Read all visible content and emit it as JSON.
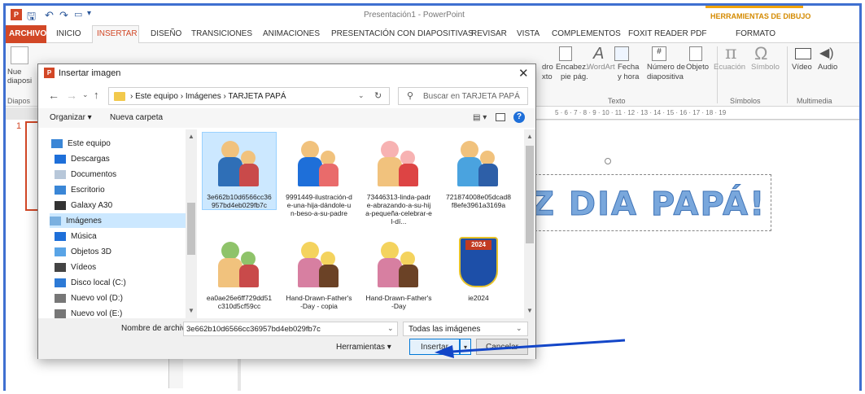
{
  "title_bar": {
    "title": "Presentación1 - PowerPoint",
    "contextual_title": "HERRAMIENTAS DE DIBUJO"
  },
  "tabs": [
    "ARCHIVO",
    "INICIO",
    "INSERTAR",
    "DISEÑO",
    "TRANSICIONES",
    "ANIMACIONES",
    "PRESENTACIÓN CON DIAPOSITIVAS",
    "REVISAR",
    "VISTA",
    "COMPLEMENTOS",
    "FOXIT READER PDF",
    "FORMATO"
  ],
  "ribbon": {
    "left_new_slide": "Nue diaposi",
    "left_group": "Diapos",
    "text_items": [
      "dro",
      "xto",
      "Encabez.",
      "pie pág.",
      "WordArt",
      "Fecha",
      "y hora",
      "Número de",
      "diapositiva",
      "Objeto"
    ],
    "text_group": "Texto",
    "symbols": [
      "Ecuación",
      "Símbolo"
    ],
    "symbols_group": "Símbolos",
    "media": [
      "Vídeo",
      "Audio"
    ],
    "media_group": "Multimedia"
  },
  "ruler": "5 · 6 · 7 · 8 · 9 · 10 · 11 · 12 · 13 · 14 · 15 · 16 · 17 · 18 · 19",
  "slide": {
    "number": "1",
    "wordart": "Z DIA PAPÁ!"
  },
  "dialog": {
    "title": "Insertar imagen",
    "breadcrumb": [
      "Este equipo",
      "Imágenes",
      "TARJETA PAPÁ"
    ],
    "search_placeholder": "Buscar en TARJETA PAPÁ",
    "organize": "Organizar ▾",
    "new_folder": "Nueva carpeta",
    "nav_items": [
      "Este equipo",
      "Descargas",
      "Documentos",
      "Escritorio",
      "Galaxy A30",
      "Imágenes",
      "Música",
      "Objetos 3D",
      "Vídeos",
      "Disco local (C:)",
      "Nuevo vol (D:)",
      "Nuevo vol (E:)"
    ],
    "nav_selected": "Imágenes",
    "files": [
      {
        "name": "3e662b10d6566cc36957bd4eb029fb7c",
        "selected": true
      },
      {
        "name": "9991449-ilustración-de-una-hija-dándole-un-beso-a-su-padre"
      },
      {
        "name": "73446313-linda-padre-abrazando-a-su-hija-pequeña-celebrar-el-dí..."
      },
      {
        "name": "721874008e05dcad8f8efe3961a3169a"
      },
      {
        "name": "ea0ae26e6ff729dd51c310d5cf59cc"
      },
      {
        "name": "Hand-Drawn-Father's-Day - copia"
      },
      {
        "name": "Hand-Drawn-Father's-Day"
      },
      {
        "name": "ie2024",
        "badge_text": "2024"
      }
    ],
    "file_name_label": "Nombre de archivo:",
    "file_name_value": "3e662b10d6566cc36957bd4eb029fb7c",
    "filter": "Todas las imágenes",
    "tools": "Herramientas",
    "insert": "Insertar",
    "cancel": "Cancelar"
  },
  "colors": {
    "accent": "#2b579a",
    "archivo": "#d24726",
    "contextual": "#f0a30a",
    "slide_text": "#79a7dc",
    "selection": "#cce8ff",
    "arrow": "#1346c8"
  }
}
